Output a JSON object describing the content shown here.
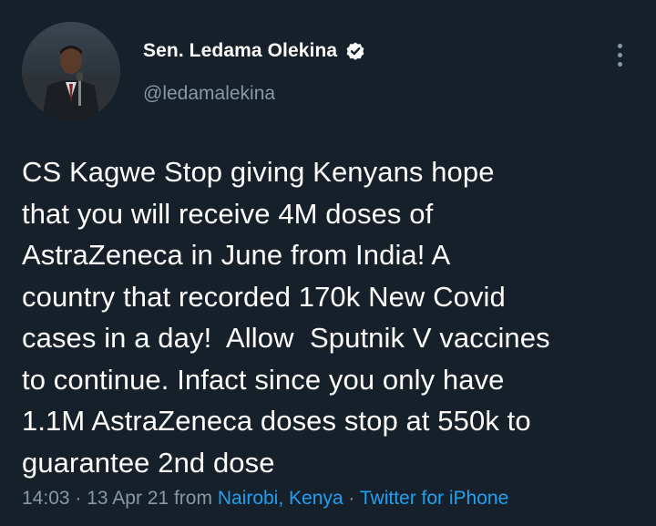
{
  "author": {
    "display_name": "Sen. Ledama Olekina",
    "handle": "@ledamalekina",
    "verified": true
  },
  "tweet": {
    "text": "CS Kagwe Stop giving Kenyans hope\nthat you will receive 4M doses of\nAstraZeneca in June from India! A\ncountry that recorded 170k New Covid\ncases in a day!  Allow  Sputnik V vaccines\nto continue. Infact since you only have\n1.1M AstraZeneca doses stop at 550k to\nguarantee 2nd dose"
  },
  "meta": {
    "time": "14:03",
    "separator1": " · ",
    "date": "13 Apr 21",
    "from_word": " from ",
    "location": "Nairobi, Kenya",
    "separator2": " · ",
    "source": "Twitter for iPhone"
  },
  "icons": {
    "verified": "verified-badge-icon",
    "more": "more-options-icon"
  },
  "colors": {
    "background": "#15202b",
    "text_primary": "#ffffff",
    "text_secondary": "#8899a6",
    "link": "#1da1f2"
  }
}
